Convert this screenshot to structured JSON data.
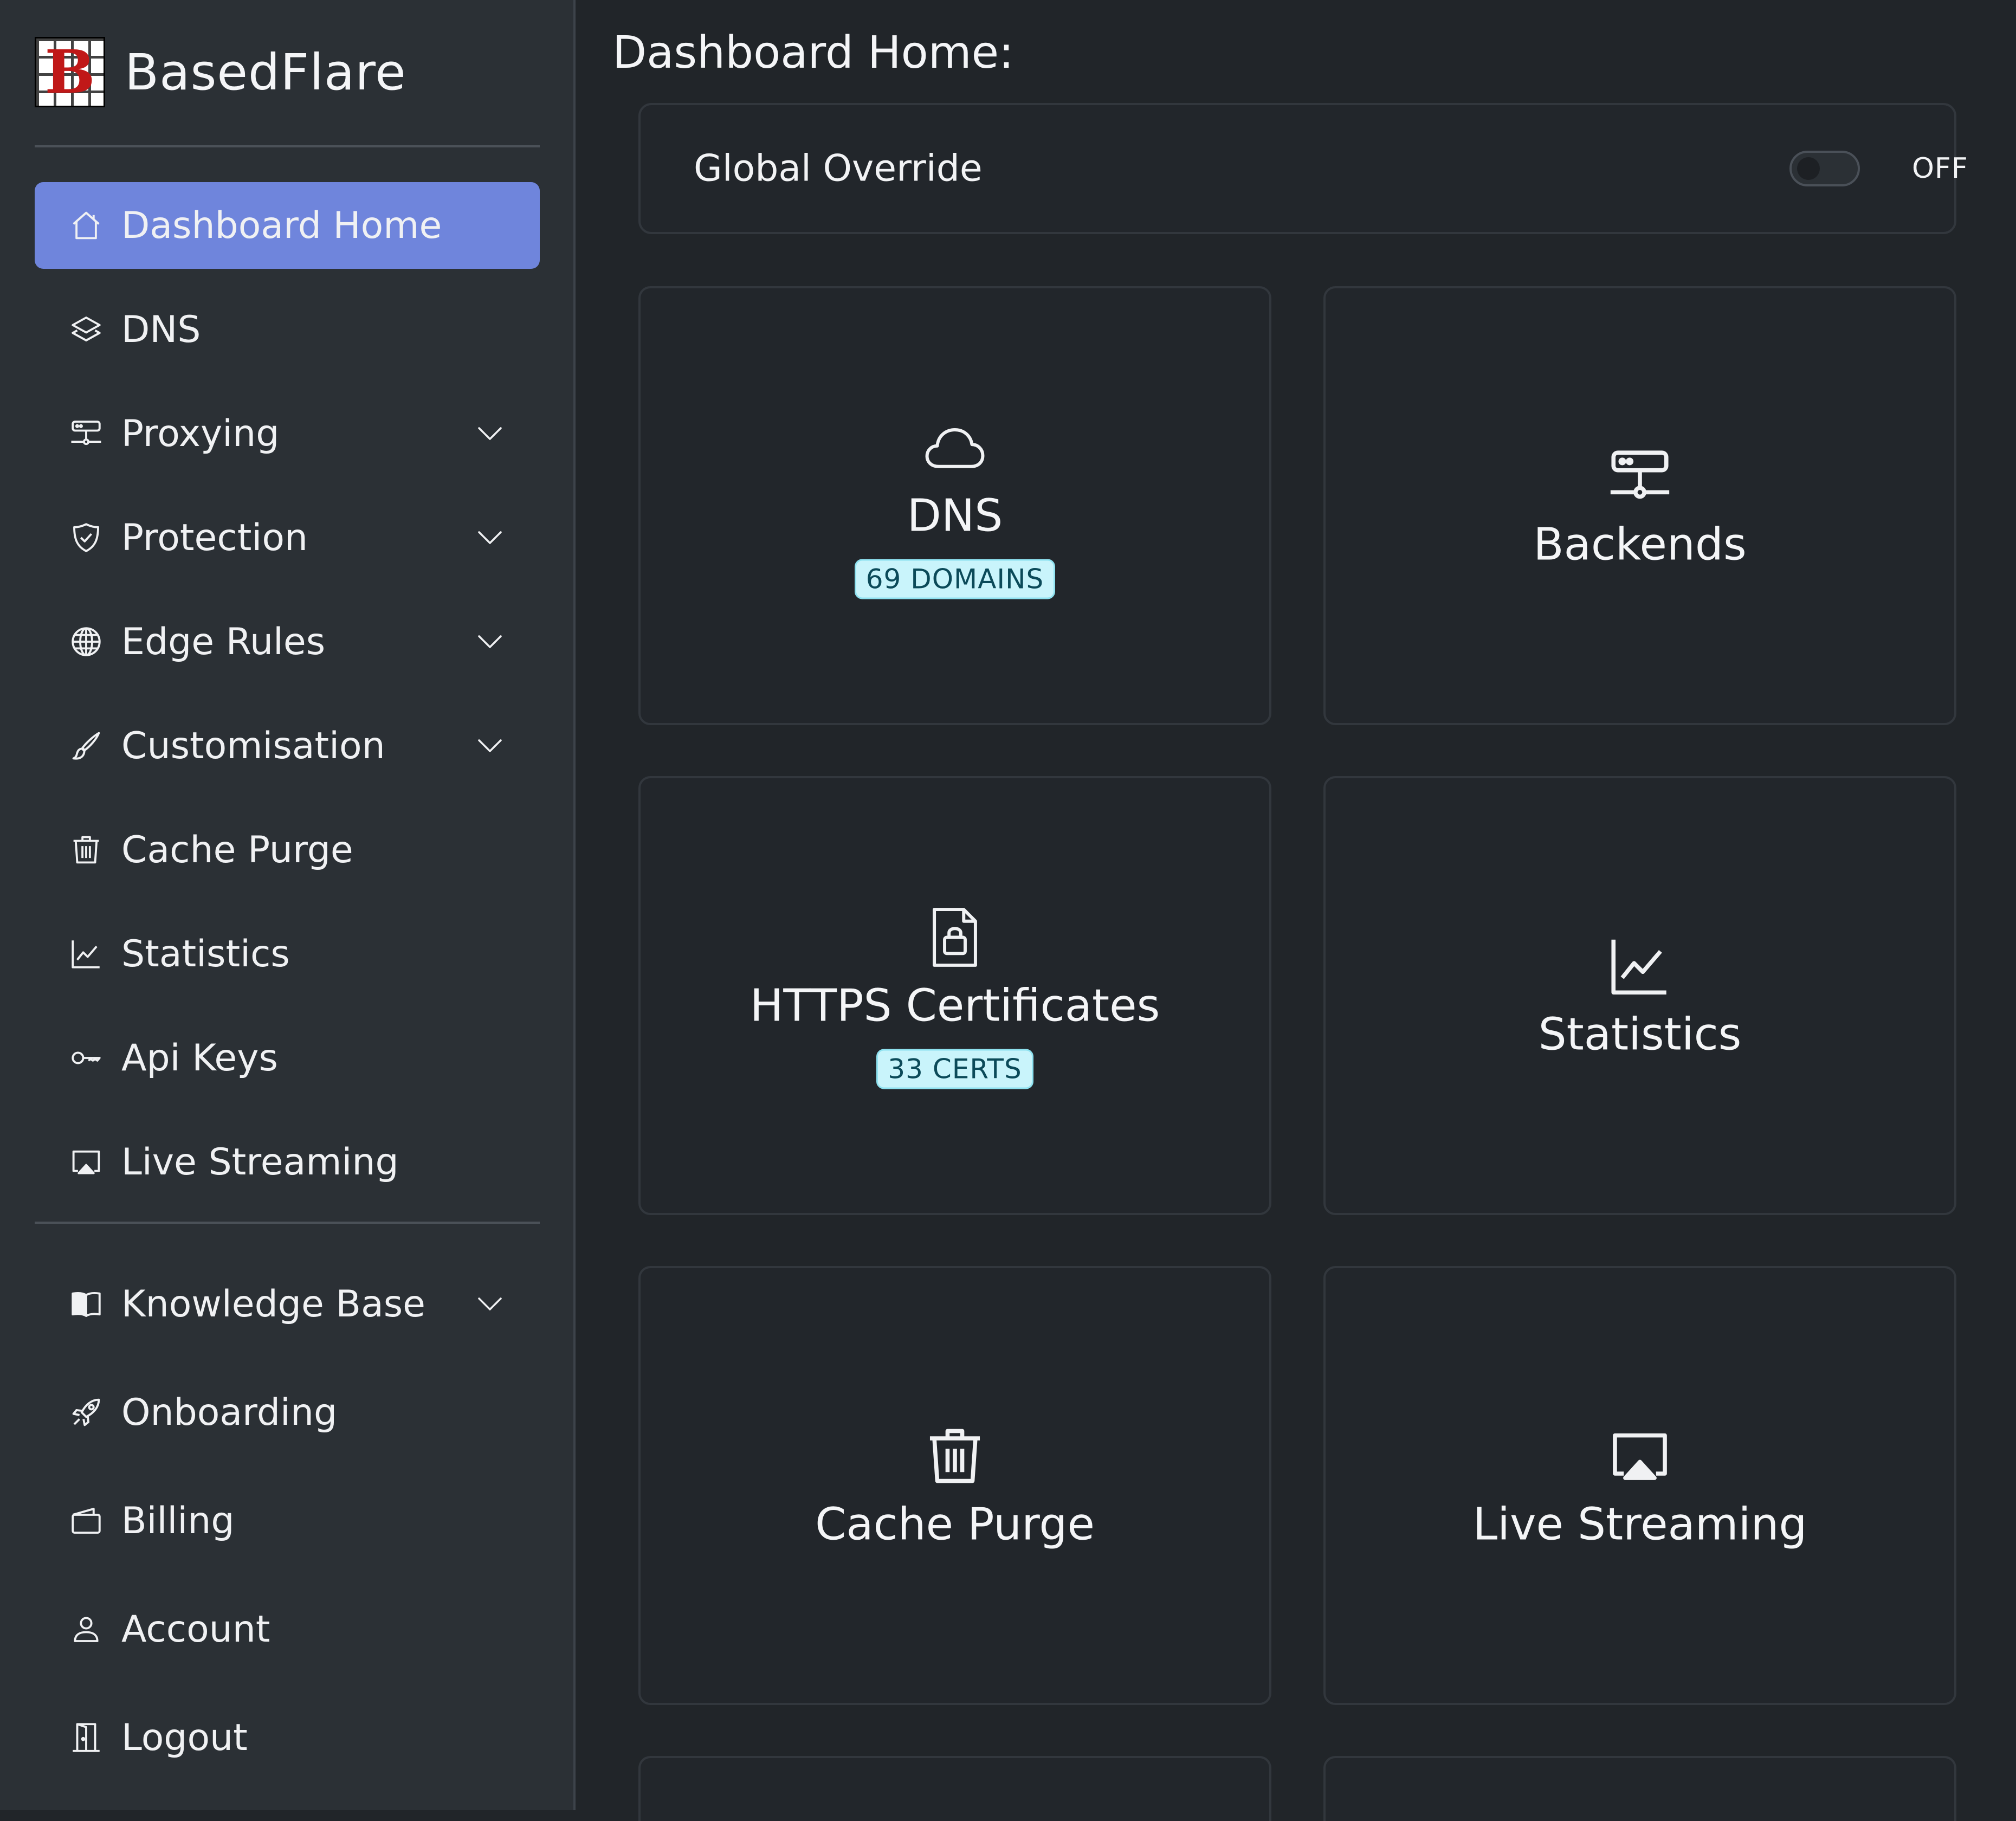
{
  "brand": {
    "name": "BasedFlare",
    "logo_letter": "B",
    "logo_icon": "basedflare-logo-icon"
  },
  "sidebar": {
    "items": [
      {
        "label": "Dashboard Home",
        "icon": "home-icon",
        "active": true,
        "expandable": false
      },
      {
        "label": "DNS",
        "icon": "layers-icon",
        "active": false,
        "expandable": false
      },
      {
        "label": "Proxying",
        "icon": "server-icon",
        "active": false,
        "expandable": true
      },
      {
        "label": "Protection",
        "icon": "shield-check-icon",
        "active": false,
        "expandable": true
      },
      {
        "label": "Edge Rules",
        "icon": "globe-icon",
        "active": false,
        "expandable": true
      },
      {
        "label": "Customisation",
        "icon": "brush-icon",
        "active": false,
        "expandable": true
      },
      {
        "label": "Cache Purge",
        "icon": "trash-icon",
        "active": false,
        "expandable": false
      },
      {
        "label": "Statistics",
        "icon": "graph-up-icon",
        "active": false,
        "expandable": false
      },
      {
        "label": "Api Keys",
        "icon": "key-icon",
        "active": false,
        "expandable": false
      },
      {
        "label": "Live Streaming",
        "icon": "airplay-icon",
        "active": false,
        "expandable": false
      }
    ],
    "secondary_items": [
      {
        "label": "Knowledge Base",
        "icon": "book-icon",
        "active": false,
        "expandable": true
      },
      {
        "label": "Onboarding",
        "icon": "rocket-icon",
        "active": false,
        "expandable": false
      },
      {
        "label": "Billing",
        "icon": "wallet-icon",
        "active": false,
        "expandable": false
      },
      {
        "label": "Account",
        "icon": "person-icon",
        "active": false,
        "expandable": false
      },
      {
        "label": "Logout",
        "icon": "door-icon",
        "active": false,
        "expandable": false
      }
    ]
  },
  "main": {
    "title": "Dashboard Home:",
    "global_override": {
      "label": "Global Override",
      "state": "OFF",
      "enabled": false
    },
    "tiles": [
      {
        "title": "DNS",
        "icon": "cloud-icon",
        "badge": "69 DOMAINS"
      },
      {
        "title": "Backends",
        "icon": "server-icon",
        "badge": ""
      },
      {
        "title": "HTTPS Certificates",
        "icon": "file-lock-icon",
        "badge": "33 CERTS"
      },
      {
        "title": "Statistics",
        "icon": "graph-up-icon",
        "badge": ""
      },
      {
        "title": "Cache Purge",
        "icon": "trash-icon",
        "badge": ""
      },
      {
        "title": "Live Streaming",
        "icon": "airplay-icon",
        "badge": ""
      }
    ]
  },
  "colors": {
    "accent": "#6f85dc",
    "background": "#212529",
    "sidebar": "#2b3035",
    "badge_bg": "#c9f4fb",
    "badge_text": "#0b4a59"
  }
}
